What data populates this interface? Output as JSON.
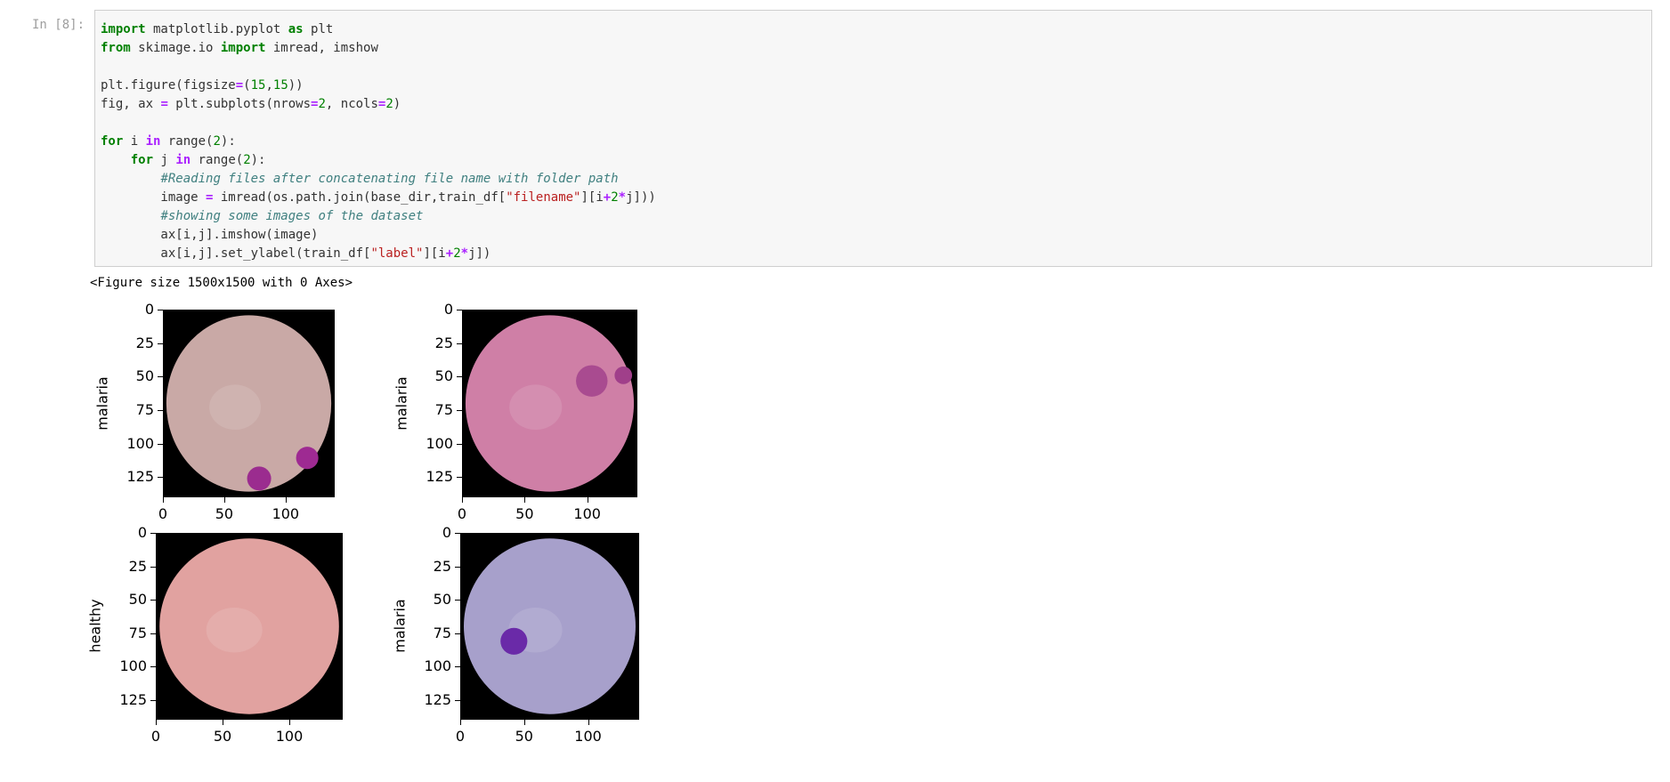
{
  "cell": {
    "prompt": "In [8]:",
    "code_lines": [
      [
        {
          "t": "import",
          "c": "kw"
        },
        {
          "t": " matplotlib.pyplot "
        },
        {
          "t": "as",
          "c": "kw"
        },
        {
          "t": " plt"
        }
      ],
      [
        {
          "t": "from",
          "c": "kw"
        },
        {
          "t": " skimage.io "
        },
        {
          "t": "import",
          "c": "kw"
        },
        {
          "t": " imread, imshow"
        }
      ],
      [],
      [
        {
          "t": "plt.figure(figsize"
        },
        {
          "t": "=",
          "c": "op"
        },
        {
          "t": "("
        },
        {
          "t": "15",
          "c": "num"
        },
        {
          "t": ","
        },
        {
          "t": "15",
          "c": "num"
        },
        {
          "t": "))"
        }
      ],
      [
        {
          "t": "fig, ax "
        },
        {
          "t": "=",
          "c": "op"
        },
        {
          "t": " plt.subplots(nrows"
        },
        {
          "t": "=",
          "c": "op"
        },
        {
          "t": "2",
          "c": "num"
        },
        {
          "t": ", ncols"
        },
        {
          "t": "=",
          "c": "op"
        },
        {
          "t": "2",
          "c": "num"
        },
        {
          "t": ")"
        }
      ],
      [],
      [
        {
          "t": "for",
          "c": "kw"
        },
        {
          "t": " i "
        },
        {
          "t": "in",
          "c": "op"
        },
        {
          "t": " range("
        },
        {
          "t": "2",
          "c": "num"
        },
        {
          "t": "):"
        }
      ],
      [
        {
          "t": "    "
        },
        {
          "t": "for",
          "c": "kw"
        },
        {
          "t": " j "
        },
        {
          "t": "in",
          "c": "op"
        },
        {
          "t": " range("
        },
        {
          "t": "2",
          "c": "num"
        },
        {
          "t": "):"
        }
      ],
      [
        {
          "t": "        "
        },
        {
          "t": "#Reading files after concatenating file name with folder path",
          "c": "cmt"
        }
      ],
      [
        {
          "t": "        image "
        },
        {
          "t": "=",
          "c": "op"
        },
        {
          "t": " imread(os.path.join(base_dir,train_df["
        },
        {
          "t": "\"filename\"",
          "c": "str"
        },
        {
          "t": "][i"
        },
        {
          "t": "+",
          "c": "op"
        },
        {
          "t": "2",
          "c": "num"
        },
        {
          "t": "*",
          "c": "op"
        },
        {
          "t": "j]))"
        }
      ],
      [
        {
          "t": "        "
        },
        {
          "t": "#showing some images of the dataset",
          "c": "cmt"
        }
      ],
      [
        {
          "t": "        ax[i,j].imshow(image)"
        }
      ],
      [
        {
          "t": "        ax[i,j].set_ylabel(train_df["
        },
        {
          "t": "\"label\"",
          "c": "str"
        },
        {
          "t": "][i"
        },
        {
          "t": "+",
          "c": "op"
        },
        {
          "t": "2",
          "c": "num"
        },
        {
          "t": "*",
          "c": "op"
        },
        {
          "t": "j])"
        }
      ]
    ]
  },
  "output": {
    "text": "<Figure size 1500x1500 with 0 Axes>"
  },
  "figure": {
    "panels": [
      {
        "ylabel": "malaria",
        "yticks": [
          "0",
          "25",
          "50",
          "75",
          "100",
          "125"
        ],
        "xticks": [
          "0",
          "50",
          "100"
        ],
        "cell_color": "#c9a9a6",
        "spots": [
          {
            "cx": 0.56,
            "cy": 0.9,
            "r": 0.07,
            "color": "#9b2c8f"
          },
          {
            "cx": 0.84,
            "cy": 0.79,
            "r": 0.065,
            "color": "#9e2a92"
          }
        ]
      },
      {
        "ylabel": "malaria",
        "yticks": [
          "0",
          "25",
          "50",
          "75",
          "100",
          "125"
        ],
        "xticks": [
          "0",
          "50",
          "100"
        ],
        "cell_color": "#cf7fa6",
        "spots": [
          {
            "cx": 0.74,
            "cy": 0.38,
            "r": 0.09,
            "color": "#a94b90"
          },
          {
            "cx": 0.92,
            "cy": 0.35,
            "r": 0.05,
            "color": "#a03f8a"
          }
        ]
      },
      {
        "ylabel": "healthy",
        "yticks": [
          "0",
          "25",
          "50",
          "75",
          "100",
          "125"
        ],
        "xticks": [
          "0",
          "50",
          "100"
        ],
        "cell_color": "#e1a2a0",
        "spots": []
      },
      {
        "ylabel": "malaria",
        "yticks": [
          "0",
          "25",
          "50",
          "75",
          "100",
          "125"
        ],
        "xticks": [
          "0",
          "50",
          "100"
        ],
        "cell_color": "#a7a0cb",
        "spots": [
          {
            "cx": 0.3,
            "cy": 0.58,
            "r": 0.075,
            "color": "#6a2aa8"
          }
        ]
      }
    ],
    "colors": {
      "background": "#000000",
      "code_bg": "#f7f7f7",
      "code_border": "#cfcfcf"
    }
  }
}
